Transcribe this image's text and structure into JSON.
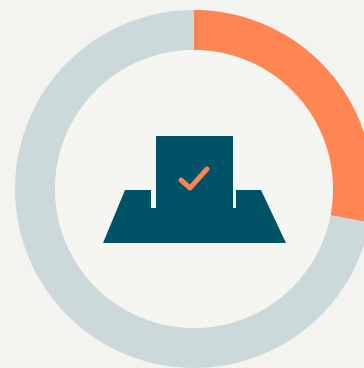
{
  "progress": {
    "fraction": 0.28
  },
  "colors": {
    "background": "#f3f3ef",
    "track": "#ccd9da",
    "accent": "#ff8552",
    "icon": "#005266",
    "inner": "#f5f5f1"
  },
  "icons": {
    "center": "ballot-box-icon",
    "check": "checkmark-icon"
  }
}
